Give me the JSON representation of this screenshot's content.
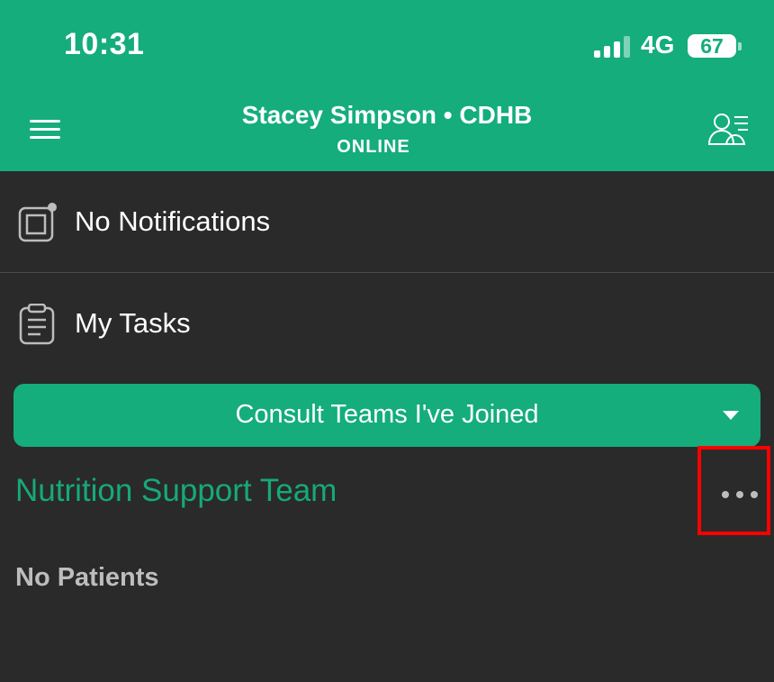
{
  "status_bar": {
    "time": "10:31",
    "network": "4G",
    "battery": "67",
    "signal_bars": 4,
    "signal_bars_filled": 3
  },
  "header": {
    "menu_icon": "hamburger-menu-icon",
    "title": "Stacey Simpson • CDHB",
    "status": "ONLINE",
    "contacts_icon": "contacts-list-icon"
  },
  "notifications": {
    "icon": "notification-square-icon",
    "label": "No Notifications"
  },
  "tasks": {
    "icon": "clipboard-icon",
    "label": "My Tasks"
  },
  "team_filter": {
    "label": "Consult Teams I've Joined",
    "caret_icon": "caret-down-icon"
  },
  "team": {
    "name": "Nutrition Support Team",
    "more_icon": "more-horizontal-icon",
    "empty_text": "No Patients"
  },
  "colors": {
    "primary": "#14ad7b",
    "background": "#2a2a2a",
    "team_name": "#16a97a",
    "highlight": "#ff0000",
    "muted_text": "#bdbdbd"
  }
}
